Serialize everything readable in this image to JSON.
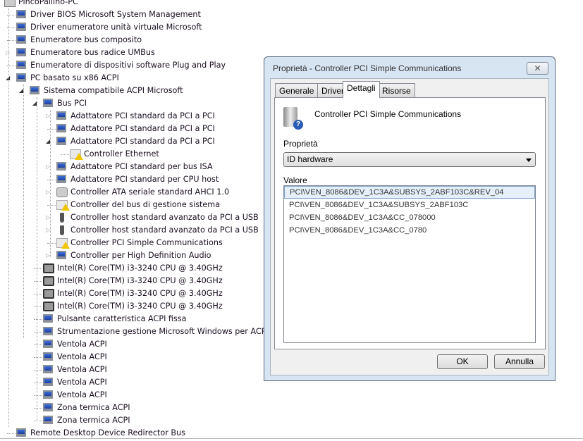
{
  "tree": [
    {
      "level": 0,
      "exp": "none",
      "icon": "pc",
      "label": "PincoPallino-PC"
    },
    {
      "level": 1,
      "exp": "none",
      "icon": "mon",
      "label": "Driver BIOS Microsoft System Management"
    },
    {
      "level": 1,
      "exp": "none",
      "icon": "mon",
      "label": "Driver enumeratore unità virtuale Microsoft"
    },
    {
      "level": 1,
      "exp": "none",
      "icon": "mon",
      "label": "Enumeratore bus composito"
    },
    {
      "level": 1,
      "exp": "collapsed",
      "icon": "mon",
      "label": "Enumeratore bus radice UMBus"
    },
    {
      "level": 1,
      "exp": "none",
      "icon": "mon",
      "label": "Enumeratore di dispositivi software Plug and Play"
    },
    {
      "level": 1,
      "exp": "expanded",
      "icon": "mon",
      "label": "PC basato su x86 ACPI"
    },
    {
      "level": 2,
      "exp": "expanded",
      "icon": "mon",
      "label": "Sistema compatibile ACPI Microsoft"
    },
    {
      "level": 3,
      "exp": "expanded",
      "icon": "mon",
      "label": "Bus PCI"
    },
    {
      "level": 4,
      "exp": "collapsed",
      "icon": "mon",
      "label": "Adattatore PCI standard da PCI a PCI"
    },
    {
      "level": 4,
      "exp": "none",
      "icon": "mon",
      "label": "Adattatore PCI standard da PCI a PCI"
    },
    {
      "level": 4,
      "exp": "expanded",
      "icon": "mon",
      "label": "Adattatore PCI standard da PCI a PCI"
    },
    {
      "level": 5,
      "exp": "none",
      "icon": "warn",
      "label": "Controller Ethernet"
    },
    {
      "level": 4,
      "exp": "collapsed",
      "icon": "mon",
      "label": "Adattatore PCI standard per bus ISA"
    },
    {
      "level": 4,
      "exp": "none",
      "icon": "mon",
      "label": "Adattatore PCI standard per CPU host"
    },
    {
      "level": 4,
      "exp": "collapsed",
      "icon": "sata",
      "label": "Controller ATA seriale standard AHCI 1.0"
    },
    {
      "level": 4,
      "exp": "none",
      "icon": "warn",
      "label": "Controller del bus di gestione sistema"
    },
    {
      "level": 4,
      "exp": "collapsed",
      "icon": "usb",
      "label": "Controller host standard avanzato da PCI a USB"
    },
    {
      "level": 4,
      "exp": "collapsed",
      "icon": "usb",
      "label": "Controller host standard avanzato da PCI a USB"
    },
    {
      "level": 4,
      "exp": "none",
      "icon": "warn",
      "label": "Controller PCI Simple Communications"
    },
    {
      "level": 4,
      "exp": "collapsed",
      "icon": "mon",
      "label": "Controller per High Definition Audio"
    },
    {
      "level": 3,
      "exp": "none",
      "icon": "cpu",
      "label": "Intel(R) Core(TM) i3-3240 CPU @ 3.40GHz"
    },
    {
      "level": 3,
      "exp": "none",
      "icon": "cpu",
      "label": "Intel(R) Core(TM) i3-3240 CPU @ 3.40GHz"
    },
    {
      "level": 3,
      "exp": "none",
      "icon": "cpu",
      "label": "Intel(R) Core(TM) i3-3240 CPU @ 3.40GHz"
    },
    {
      "level": 3,
      "exp": "none",
      "icon": "cpu",
      "label": "Intel(R) Core(TM) i3-3240 CPU @ 3.40GHz"
    },
    {
      "level": 3,
      "exp": "none",
      "icon": "mon",
      "label": "Pulsante caratteristica ACPI fissa"
    },
    {
      "level": 3,
      "exp": "none",
      "icon": "mon",
      "label": "Strumentazione gestione Microsoft Windows per ACPI"
    },
    {
      "level": 3,
      "exp": "none",
      "icon": "mon",
      "label": "Ventola ACPI"
    },
    {
      "level": 3,
      "exp": "none",
      "icon": "mon",
      "label": "Ventola ACPI"
    },
    {
      "level": 3,
      "exp": "none",
      "icon": "mon",
      "label": "Ventola ACPI"
    },
    {
      "level": 3,
      "exp": "none",
      "icon": "mon",
      "label": "Ventola ACPI"
    },
    {
      "level": 3,
      "exp": "none",
      "icon": "mon",
      "label": "Ventola ACPI"
    },
    {
      "level": 3,
      "exp": "none",
      "icon": "mon",
      "label": "Zona termica ACPI"
    },
    {
      "level": 3,
      "exp": "none",
      "icon": "mon",
      "label": "Zona termica ACPI"
    },
    {
      "level": 1,
      "exp": "none",
      "icon": "mon",
      "label": "Remote Desktop Device Redirector Bus"
    }
  ],
  "dialog": {
    "title": "Proprietà - Controller PCI Simple Communications",
    "close": "✕",
    "tabs": [
      "Generale",
      "Driver",
      "Dettagli",
      "Risorse"
    ],
    "active_tab": "Dettagli",
    "device_name": "Controller PCI Simple Communications",
    "property_label": "Proprietà",
    "property_value": "ID hardware",
    "value_label": "Valore",
    "values": [
      "PCI\\VEN_8086&DEV_1C3A&SUBSYS_2ABF103C&REV_04",
      "PCI\\VEN_8086&DEV_1C3A&SUBSYS_2ABF103C",
      "PCI\\VEN_8086&DEV_1C3A&CC_078000",
      "PCI\\VEN_8086&DEV_1C3A&CC_0780"
    ],
    "ok": "OK",
    "cancel": "Annulla"
  }
}
